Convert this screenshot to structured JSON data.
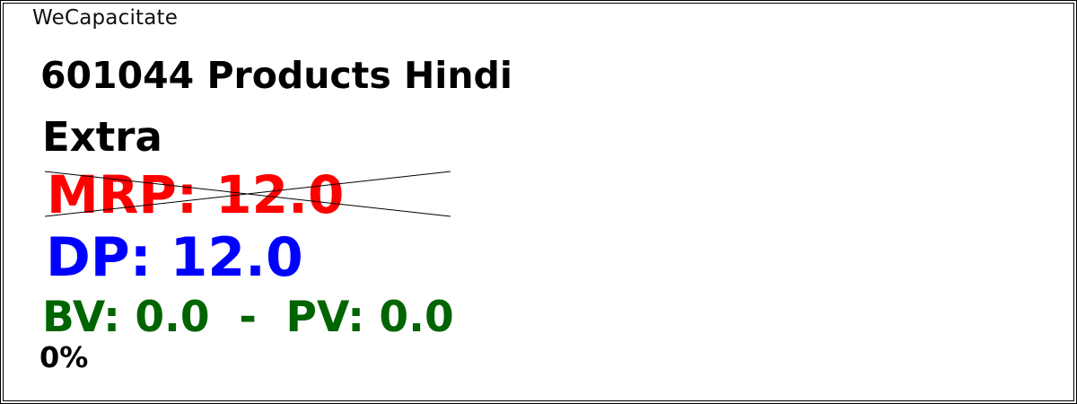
{
  "label": {
    "brand": "WeCapacitate",
    "product_title": "601044 Products Hindi",
    "product_subtitle": "Extra",
    "mrp_text": "MRP: 12.0",
    "dp_text": "DP: 12.0",
    "bv_pv_text": "BV: 0.0  -  PV: 0.0",
    "discount_text": "0%"
  },
  "colors": {
    "mrp": "#ff0000",
    "dp": "#0000ff",
    "bv_pv": "#006400",
    "text": "#000000"
  }
}
